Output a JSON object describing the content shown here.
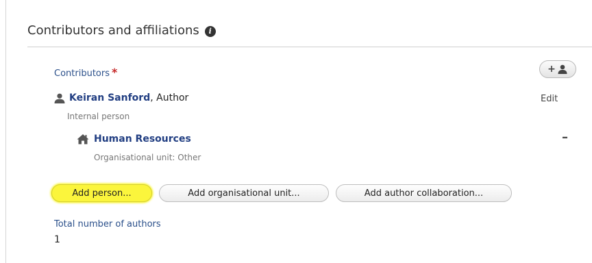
{
  "section": {
    "title": "Contributors and affiliations",
    "info_icon": "info-icon"
  },
  "contributors": {
    "label": "Contributors",
    "required_marker": "*",
    "add_icon": "add-person-icon",
    "person": {
      "name": "Keiran Sanford",
      "role": ", Author",
      "type": "Internal person",
      "edit_label": "Edit",
      "icon": "person-icon"
    },
    "organisation": {
      "name": "Human Resources",
      "type": "Organisational unit: Other",
      "remove_label": "–",
      "icon": "home-icon"
    }
  },
  "buttons": {
    "add_person": "Add person...",
    "add_org_unit": "Add organisational unit...",
    "add_author_collab": "Add author collaboration..."
  },
  "total_authors": {
    "label": "Total number of authors",
    "value": "1"
  },
  "colors": {
    "link": "#213e82",
    "label": "#2a4f8a",
    "required": "#c62a2a",
    "highlight": "#fbf53c"
  }
}
